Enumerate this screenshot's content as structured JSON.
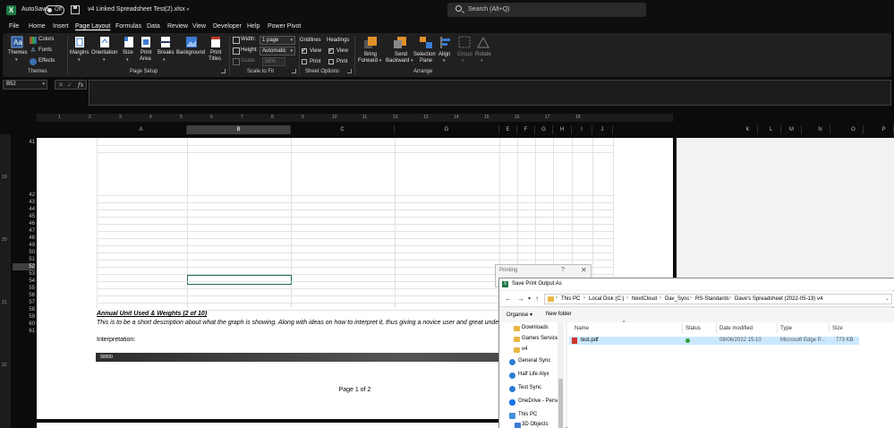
{
  "app": {
    "autosave_label": "AutoSave",
    "autosave_state": "Off",
    "doc_title": "v4 Linked Spreadsheet Test(2).xlsx",
    "search_placeholder": "Search (Alt+Q)"
  },
  "menu": {
    "tabs": [
      "File",
      "Home",
      "Insert",
      "Page Layout",
      "Formulas",
      "Data",
      "Review",
      "View",
      "Developer",
      "Help",
      "Power Pivot"
    ],
    "active": "Page Layout"
  },
  "ribbon": {
    "themes": {
      "themes_label": "Themes",
      "colors_label": "Colors",
      "fonts_label": "Fonts",
      "effects_label": "Effects",
      "group_label": "Themes"
    },
    "page_setup": {
      "margins": "Margins",
      "orientation": "Orientation",
      "size": "Size",
      "print_area_1": "Print",
      "print_area_2": "Area",
      "breaks": "Breaks",
      "background": "Background",
      "print_titles_1": "Print",
      "print_titles_2": "Titles",
      "group_label": "Page Setup"
    },
    "scale_to_fit": {
      "width_label": "Width:",
      "width_value": "1 page",
      "height_label": "Height:",
      "height_value": "Automatic",
      "scale_label": "Scale:",
      "scale_value": "58%",
      "group_label": "Scale to Fit"
    },
    "sheet_options": {
      "gridlines": "Gridlines",
      "headings": "Headings",
      "view": "View",
      "print": "Print",
      "group_label": "Sheet Options"
    },
    "arrange": {
      "bring_forward_1": "Bring",
      "bring_forward_2": "Forward",
      "send_backward_1": "Send",
      "send_backward_2": "Backward",
      "selection_pane_1": "Selection",
      "selection_pane_2": "Pane",
      "align": "Align",
      "group": "Group",
      "rotate": "Rotate",
      "group_label": "Arrange"
    }
  },
  "formula_bar": {
    "name_box": "B52",
    "fx": "fx",
    "formula": ""
  },
  "ruler": {
    "marks": [
      "1",
      "2",
      "3",
      "4",
      "5",
      "6",
      "7",
      "8",
      "9",
      "10",
      "11",
      "12",
      "13",
      "14",
      "15",
      "16",
      "17",
      "18"
    ]
  },
  "columns": {
    "page": [
      "A",
      "B",
      "C",
      "D",
      "E",
      "F",
      "G",
      "H",
      "I",
      "J"
    ],
    "right": [
      "K",
      "L",
      "M",
      "N",
      "O",
      "P"
    ],
    "selected": "B"
  },
  "rows": {
    "numbers": [
      "41",
      "42",
      "43",
      "44",
      "45",
      "46",
      "47",
      "48",
      "49",
      "50",
      "51",
      "52",
      "53",
      "54",
      "55",
      "56",
      "57",
      "58",
      "59",
      "60",
      "61"
    ],
    "selected": "52"
  },
  "vruler": {
    "marks": [
      "19",
      "20",
      "21",
      "22"
    ]
  },
  "sheet": {
    "heading": "Annual Unit Used & Weights (2 of 10)",
    "description": "This is to be a short description about what the graph is showing. Along with ideas on how to interpret it, thus giving a novice user and great understanding.",
    "interpretation_label": "Interpretation:",
    "chart_value_label": "90000",
    "page_label": "Page 1 of 2"
  },
  "printing_dialog": {
    "title": "Printing",
    "help": "?",
    "close": "✕"
  },
  "save_dialog": {
    "title": "Save Print Output As",
    "breadcrumb": [
      "This PC",
      "Local Disk (C:)",
      "NextCloud",
      "Dav_Sync",
      "RS-Standards",
      "Dave's Spreadsheet (2022-05-13)",
      "v4"
    ],
    "organise": "Organise ▾",
    "new_folder": "New folder",
    "nav_items": [
      "Downloads",
      "Games Services",
      "v4",
      "General Sync",
      "Half Life Alyx",
      "Test Sync",
      "OneDrive - Person",
      "This PC",
      "3D Objects"
    ],
    "columns": [
      "Name",
      "Status",
      "Date modified",
      "Type",
      "Size"
    ],
    "files": [
      {
        "name": "test.pdf",
        "date": "08/06/2022 15:10",
        "type": "Microsoft Edge P...",
        "size": "773 KB"
      }
    ]
  }
}
